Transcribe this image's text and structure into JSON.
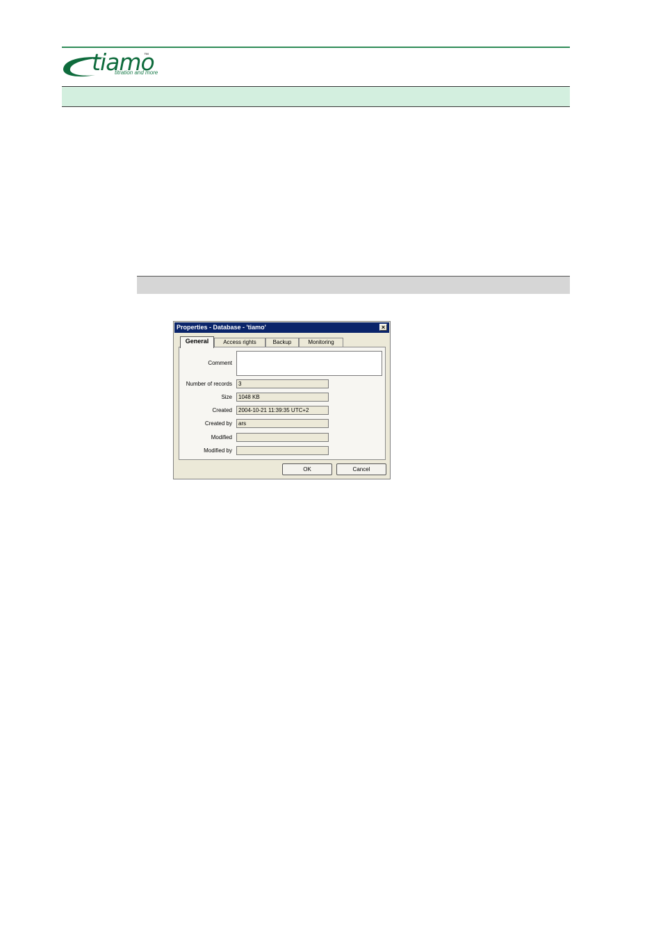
{
  "logo": {
    "word": "tiamo",
    "tm": "™",
    "tagline": "titration and more"
  },
  "dialog": {
    "title": "Properties - Database - 'tiamo'",
    "close_symbol": "×",
    "tabs": [
      "General",
      "Access rights",
      "Backup",
      "Monitoring"
    ],
    "active_tab": "General",
    "fields": {
      "comment": {
        "label": "Comment",
        "value": ""
      },
      "number_of_records": {
        "label": "Number of records",
        "value": "3"
      },
      "size": {
        "label": "Size",
        "value": "1048 KB"
      },
      "created": {
        "label": "Created",
        "value": "2004-10-21 11:39:35 UTC+2"
      },
      "created_by": {
        "label": "Created by",
        "value": "ars"
      },
      "modified": {
        "label": "Modified",
        "value": ""
      },
      "modified_by": {
        "label": "Modified by",
        "value": ""
      }
    },
    "buttons": {
      "ok": "OK",
      "cancel": "Cancel"
    }
  },
  "colors": {
    "brand_green": "#0e6b3c",
    "header_band": "#d3efdf",
    "section_band": "#d6d6d6",
    "titlebar": "#0a246a"
  }
}
